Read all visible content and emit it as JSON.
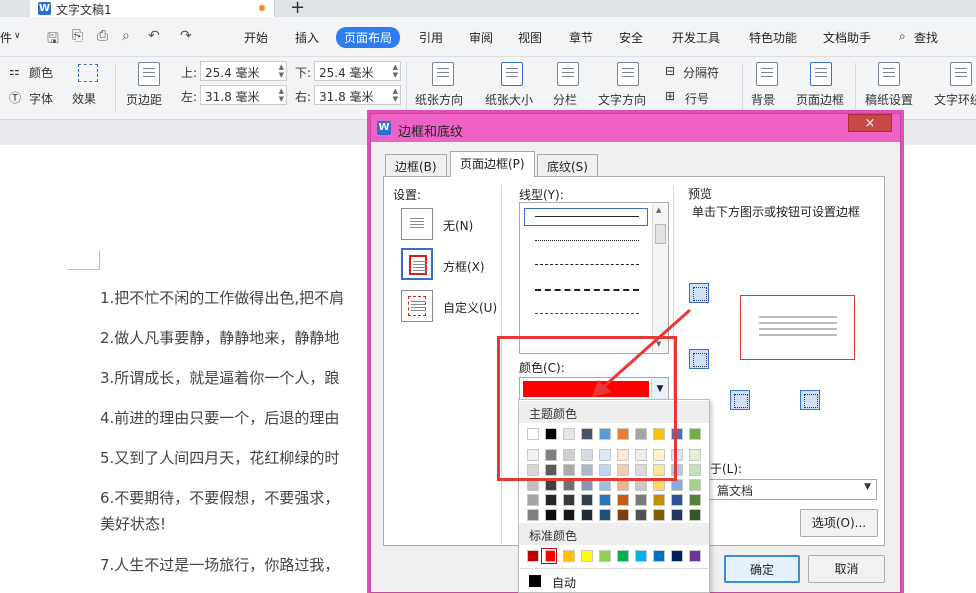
{
  "app": {
    "doc_tab": "文字文稿1",
    "file_menu": "件",
    "new_tab": "+",
    "menu": [
      "开始",
      "插入",
      "页面布局",
      "引用",
      "审阅",
      "视图",
      "章节",
      "安全",
      "开发工具",
      "特色功能",
      "文档助手"
    ],
    "search": "查找"
  },
  "ribbon": {
    "color": "颜色",
    "font": "字体",
    "effect": "效果",
    "margin": "页边距",
    "top_label": "上:",
    "top_val": "25.4 毫米",
    "bottom_label": "下:",
    "bottom_val": "25.4 毫米",
    "left_label": "左:",
    "left_val": "31.8 毫米",
    "right_label": "右:",
    "right_val": "31.8 毫米",
    "orientation": "纸张方向",
    "size": "纸张大小",
    "columns": "分栏",
    "text_dir": "文字方向",
    "separator": "分隔符",
    "line_num": "行号",
    "background": "背景",
    "page_border": "页面边框",
    "paper_setup": "稿纸设置",
    "text_wrap": "文字环绕"
  },
  "document": {
    "lines": [
      "1.把不忙不闲的工作做得出色,把不肩",
      "2.做人凡事要静，静静地来，静静地",
      "3.所谓成长，就是逼着你一个人，踉",
      "4.前进的理由只要一个，后退的理由",
      "5.又到了人间四月天，花红柳绿的时",
      "6.不要期待，不要假想，不要强求，",
      "美好状态!",
      "7.人生不过是一场旅行，你路过我，"
    ]
  },
  "dialog": {
    "title": "边框和底纹",
    "close": "×",
    "tabs": [
      "边框(B)",
      "页面边框(P)",
      "底纹(S)"
    ],
    "settings_label": "设置:",
    "settings": [
      "无(N)",
      "方框(X)",
      "自定义(U)"
    ],
    "style_label": "线型(Y):",
    "color_label": "颜色(C):",
    "selected_color": "#ff0000",
    "preview_label": "预览",
    "preview_hint": "单击下方图示或按钮可设置边框",
    "apply_label": "于(L):",
    "apply_value": "篇文档",
    "options_btn": "选项(O)...",
    "ok": "确定",
    "cancel": "取消"
  },
  "palette": {
    "theme_title": "主题颜色",
    "standard_title": "标准颜色",
    "auto_label": "自动",
    "theme_top": [
      "#ffffff",
      "#000000",
      "#e7e6e6",
      "#44546a",
      "#5b9bd5",
      "#ed7d31",
      "#a5a5a5",
      "#ffc000",
      "#4472c4",
      "#70ad47"
    ],
    "theme_shades": [
      [
        "#f2f2f2",
        "#7f7f7f",
        "#d0cece",
        "#d6dce4",
        "#deebf6",
        "#fbe5d5",
        "#ededed",
        "#fff2cc",
        "#dae3f3",
        "#e2efd9"
      ],
      [
        "#d8d8d8",
        "#595959",
        "#aeabab",
        "#adb9ca",
        "#bdd7ee",
        "#f7cbac",
        "#dbdbdb",
        "#fee599",
        "#b4c6e7",
        "#c5e0b3"
      ],
      [
        "#bfbfbf",
        "#3f3f3f",
        "#757070",
        "#8496b0",
        "#9cc3e5",
        "#f4b183",
        "#c9c9c9",
        "#ffd966",
        "#8eaadb",
        "#a8d08d"
      ],
      [
        "#a5a5a5",
        "#262626",
        "#3a3838",
        "#323f4f",
        "#2e75b5",
        "#c55a11",
        "#7b7b7b",
        "#bf9000",
        "#2f5496",
        "#538135"
      ],
      [
        "#7f7f7f",
        "#0c0c0c",
        "#171616",
        "#222a35",
        "#1e4e79",
        "#833c0b",
        "#525252",
        "#7f6000",
        "#1f3864",
        "#375623"
      ]
    ],
    "standard": [
      "#c00000",
      "#ff0000",
      "#ffc000",
      "#ffff00",
      "#92d050",
      "#00b050",
      "#00b0f0",
      "#0070c0",
      "#002060",
      "#7030a0"
    ]
  }
}
